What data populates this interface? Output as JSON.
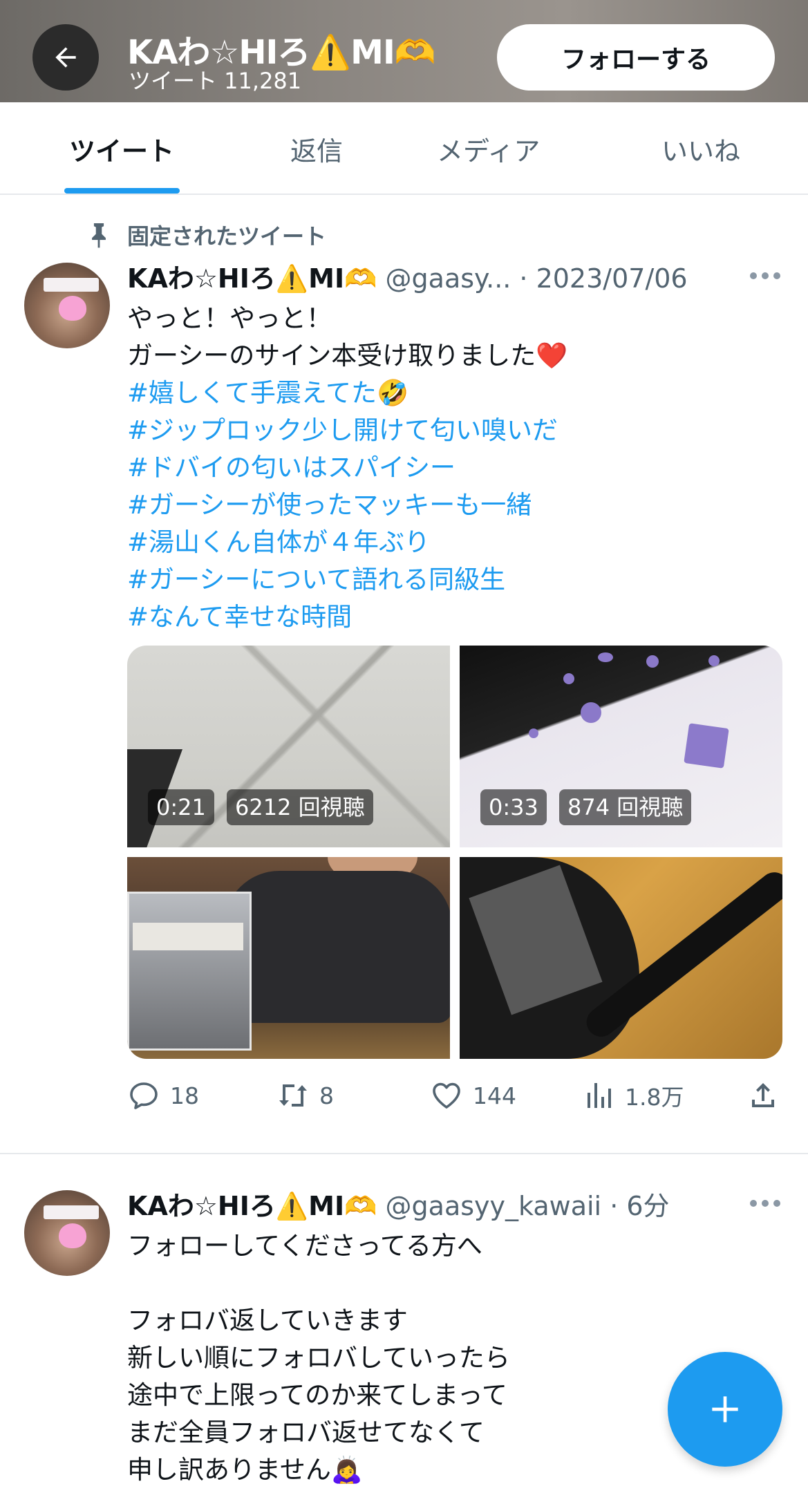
{
  "header": {
    "display_name": "KAわ☆HIろ⚠️MI🫶",
    "tweet_count": "ツイート 11,281",
    "follow_label": "フォローする"
  },
  "tabs": [
    {
      "label": "ツイート",
      "active": true
    },
    {
      "label": "返信",
      "active": false
    },
    {
      "label": "メディア",
      "active": false
    },
    {
      "label": "いいね",
      "active": false
    }
  ],
  "pinned_tweet": {
    "pinned_label": "固定されたツイート",
    "author_name": "KAわ☆HIろ⚠️MI🫶",
    "meta": "@gaasy... · 2023/07/06",
    "body_lines": [
      "やっと！やっと！",
      "ガーシーのサイン本受け取りました❤️"
    ],
    "hashtags": [
      "#嬉しくて手震えてた🤣",
      "#ジップロック少し開けて匂い嗅いだ",
      "#ドバイの匂いはスパイシー",
      "#ガーシーが使ったマッキーも一緒",
      "#湯山くん自体が４年ぶり",
      "#ガーシーについて語れる同級生",
      "#なんて幸せな時間"
    ],
    "media": [
      {
        "duration": "0:21",
        "views": "6212 回視聴"
      },
      {
        "duration": "0:33",
        "views": "874 回視聴"
      }
    ],
    "actions": {
      "replies": "18",
      "retweets": "8",
      "likes": "144",
      "views": "1.8万"
    }
  },
  "second_tweet": {
    "author_name": "KAわ☆HIろ⚠️MI🫶",
    "meta": "@gaasyy_kawaii · 6分",
    "body_lines": [
      "フォローしてくださってる方へ",
      "",
      "フォロバ返していきます",
      "新しい順にフォロバしていったら",
      "途中で上限ってのか来てしまって",
      "まだ全員フォロバ返せてなくて",
      "申し訳ありません🙇‍♀️"
    ]
  },
  "colors": {
    "accent": "#1d9bf0",
    "text_primary": "#0f1419",
    "text_secondary": "#536471"
  }
}
